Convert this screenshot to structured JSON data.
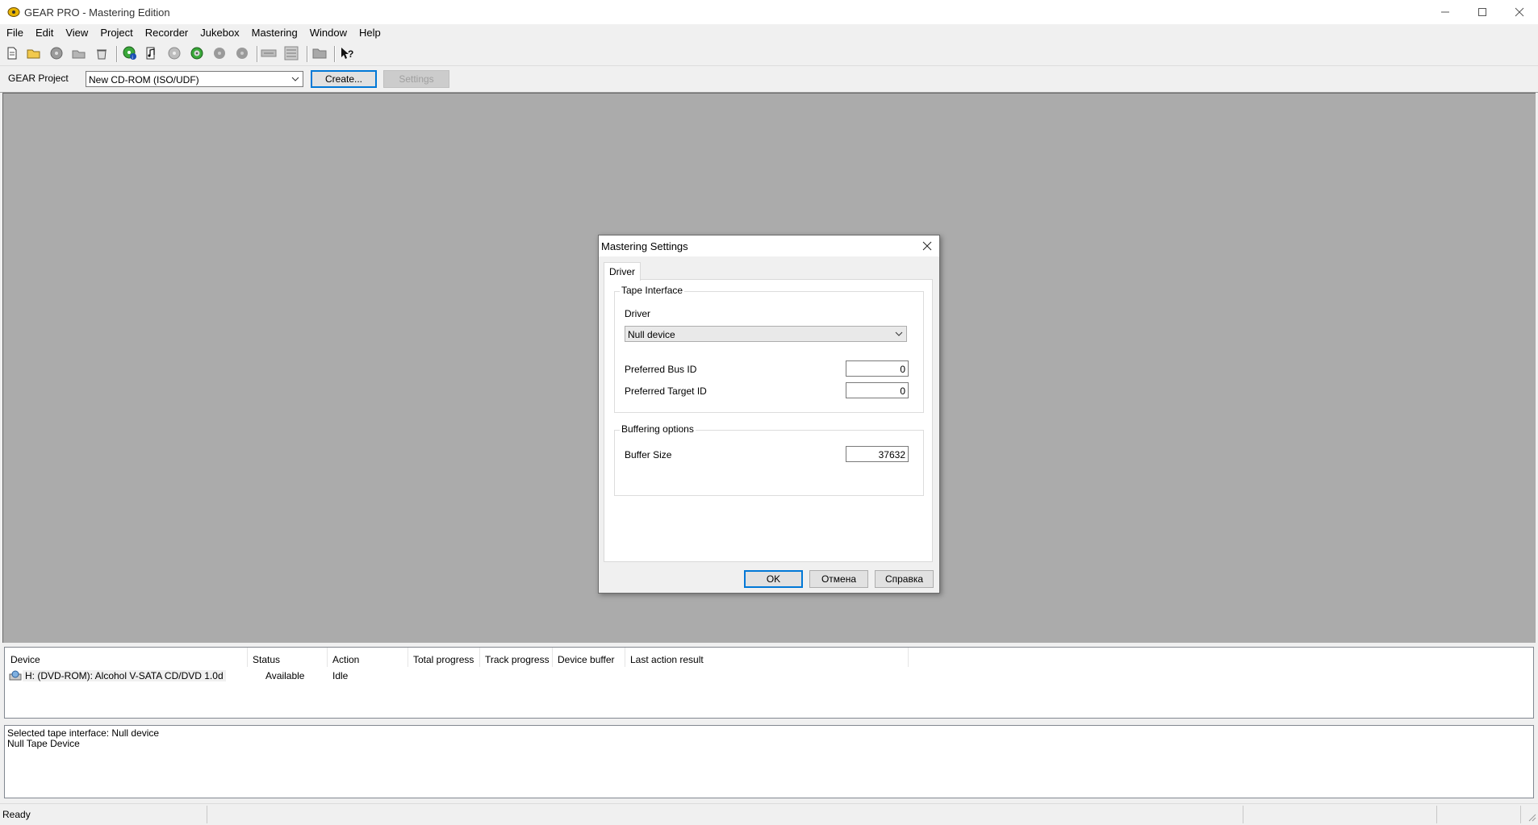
{
  "window": {
    "title": "GEAR PRO - Mastering Edition"
  },
  "menu": [
    "File",
    "Edit",
    "View",
    "Project",
    "Recorder",
    "Jukebox",
    "Mastering",
    "Window",
    "Help"
  ],
  "toolbar_icons": [
    "new-icon",
    "open-folder-icon",
    "globe-disc-icon",
    "folder-open-icon",
    "recycle-icon",
    "disc-info-icon",
    "music-disc-icon",
    "disc-gear-icon",
    "disc-play-icon",
    "disc-a-icon",
    "disc-b-icon",
    "device-icon",
    "list-icon",
    "folder-icon",
    "context-help-icon"
  ],
  "project": {
    "label": "GEAR Project",
    "type_value": "New CD-ROM (ISO/UDF)",
    "create_label": "Create...",
    "settings_label": "Settings"
  },
  "dialog": {
    "title": "Mastering Settings",
    "tab": "Driver",
    "tape_group": "Tape Interface",
    "driver_label": "Driver",
    "driver_value": "Null device",
    "bus_label": "Preferred Bus ID",
    "bus_value": "0",
    "target_label": "Preferred Target ID",
    "target_value": "0",
    "buffer_group": "Buffering options",
    "buffer_label": "Buffer Size",
    "buffer_value": "37632",
    "ok_label": "OK",
    "cancel_label": "Отмена",
    "help_label": "Справка"
  },
  "devices": {
    "columns": [
      "Device",
      "Status",
      "Action",
      "Total progress",
      "Track progress",
      "Device buffer",
      "Last action result"
    ],
    "rows": [
      {
        "device": "H: (DVD-ROM):  Alcohol V-SATA CD/DVD 1.0d",
        "status": "Available",
        "action": "Idle"
      }
    ]
  },
  "log": [
    "Selected tape interface: Null device",
    "Null Tape Device"
  ],
  "status": {
    "text": "Ready"
  }
}
